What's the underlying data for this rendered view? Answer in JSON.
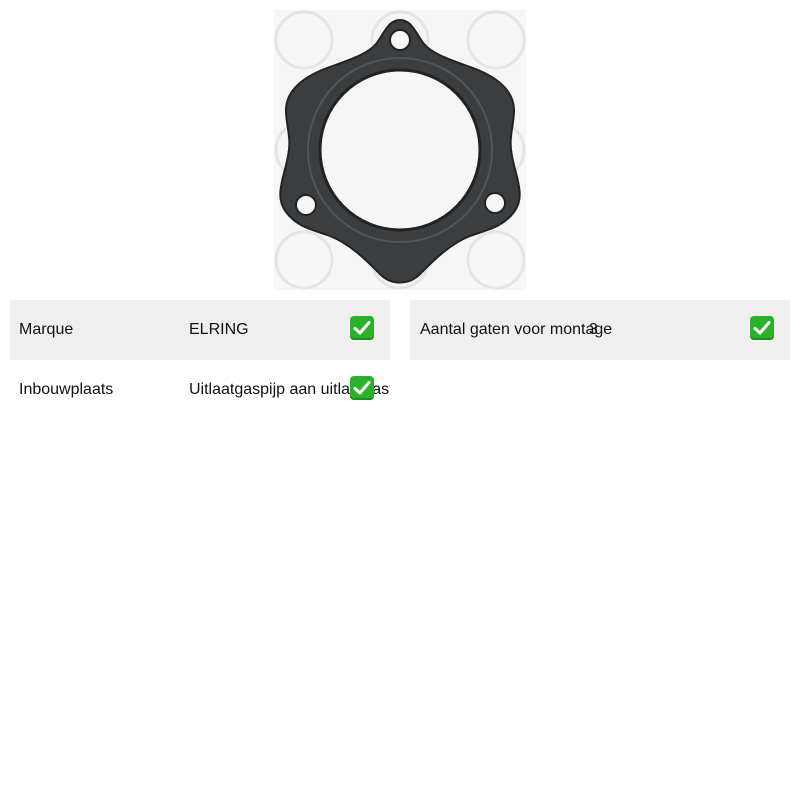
{
  "product": {
    "brand_watermark": "elring",
    "image_alt": "gasket"
  },
  "specs_left": [
    {
      "label": "Marque",
      "value": "ELRING",
      "icon": "check-icon"
    },
    {
      "label": "Inbouwplaats",
      "value": "Uitlaatgaspijp aan uitlaatgasturbo",
      "icon": "check-icon"
    }
  ],
  "specs_right": [
    {
      "label": "Aantal gaten voor montage",
      "value": "3",
      "icon": "check-icon"
    }
  ],
  "colors": {
    "row_shade": "#efefef",
    "check_green": "#2bb12b",
    "gasket": "#3a3d3f"
  }
}
